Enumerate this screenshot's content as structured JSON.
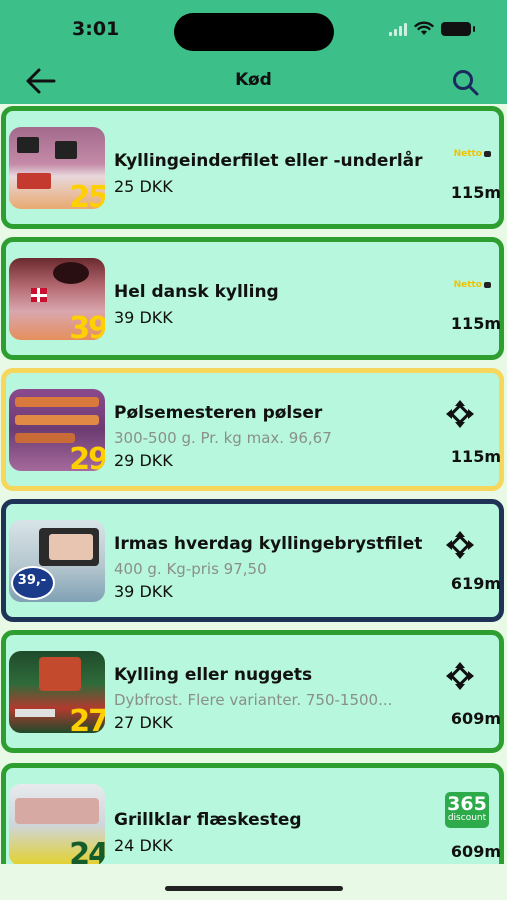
{
  "status": {
    "time": "3:01"
  },
  "header": {
    "title": "Kød"
  },
  "offers": [
    {
      "name": "Kyllingeinderfilet eller -underlår",
      "description": "",
      "price": "25 DKK",
      "distance": "115m",
      "store": "netto",
      "store_label": "Netto",
      "thumb_price": "25",
      "border": "#2f9e30"
    },
    {
      "name": "Hel dansk kylling",
      "description": "",
      "price": "39 DKK",
      "distance": "115m",
      "store": "netto",
      "store_label": "Netto",
      "thumb_price": "39",
      "border": "#2f9e30"
    },
    {
      "name": "Pølsemesteren pølser",
      "description": "300-500 g. Pr. kg max. 96,67",
      "price": "29 DKK",
      "distance": "115m",
      "store": "rema",
      "thumb_price": "29",
      "border": "#f6d65b"
    },
    {
      "name": "Irmas hverdag kyllingebrystfilet",
      "description": "400 g. Kg-pris 97,50",
      "price": "39 DKK",
      "distance": "619m",
      "store": "rema",
      "thumb_price": "39,-",
      "border": "#1e3355"
    },
    {
      "name": "Kylling eller nuggets",
      "description": "Dybfrost. Flere varianter. 750-1500...",
      "price": "27 DKK",
      "distance": "609m",
      "store": "rema",
      "thumb_price": "27",
      "border": "#2f9e30"
    },
    {
      "name": "Grillklar flæskesteg",
      "description": "",
      "price": "24 DKK",
      "distance": "609m",
      "store": "365",
      "store_label_big": "365",
      "store_label_small": "discount",
      "thumb_price": "24",
      "border": "#2f9e30"
    }
  ],
  "icons": {
    "back": "arrow-left-icon",
    "search": "search-icon",
    "store_rema": "diamond-arrows-icon"
  }
}
